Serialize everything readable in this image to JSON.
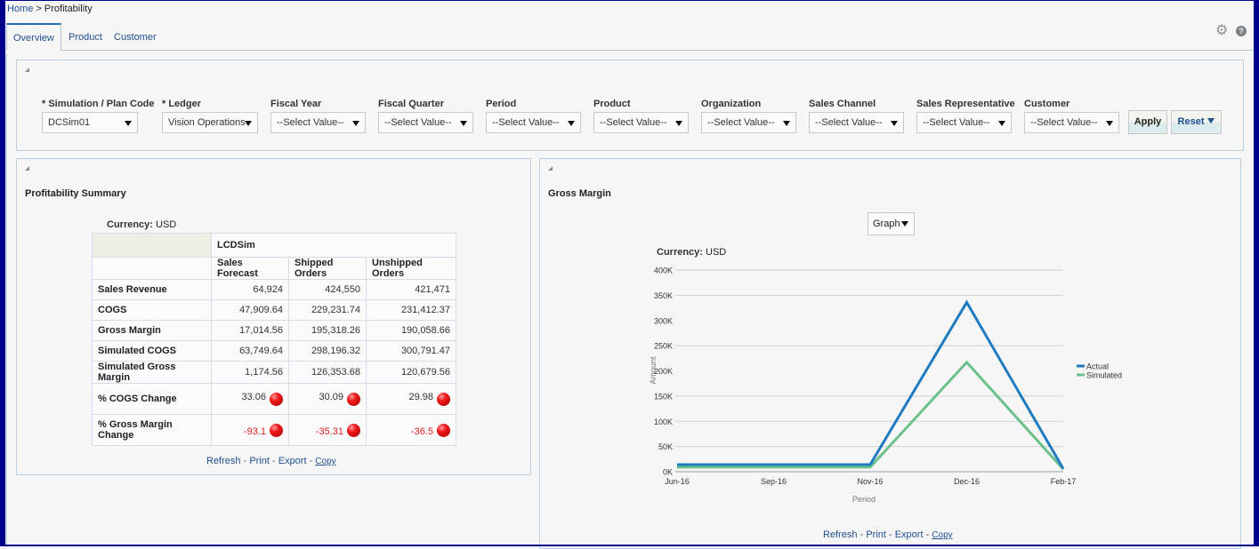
{
  "breadcrumb": {
    "home": "Home",
    "separator": " > ",
    "current": "Profitability"
  },
  "tabs": [
    {
      "label": "Overview",
      "active": true
    },
    {
      "label": "Product",
      "active": false
    },
    {
      "label": "Customer",
      "active": false
    }
  ],
  "header_icons": {
    "settings": "gear-icon",
    "help": "help-icon",
    "help_glyph": "?"
  },
  "filters": {
    "fields": [
      {
        "label": "* Simulation / Plan Code",
        "value": "DCSim01"
      },
      {
        "label": "* Ledger",
        "value": "Vision Operations"
      },
      {
        "label": "Fiscal Year",
        "value": "--Select Value--"
      },
      {
        "label": "Fiscal Quarter",
        "value": "--Select Value--"
      },
      {
        "label": "Period",
        "value": "--Select Value--"
      },
      {
        "label": "Product",
        "value": "--Select Value--"
      },
      {
        "label": "Organization",
        "value": "--Select Value--"
      },
      {
        "label": "Sales Channel",
        "value": "--Select Value--"
      },
      {
        "label": "Sales Representative",
        "value": "--Select Value--"
      },
      {
        "label": "Customer",
        "value": "--Select Value--"
      }
    ],
    "apply_label": "Apply",
    "reset_label": "Reset"
  },
  "summary": {
    "title": "Profitability Summary",
    "currency_label": "Currency:",
    "currency_value": "USD",
    "group_header": "LCDSim",
    "columns": [
      "Sales Forecast",
      "Shipped Orders",
      "Unshipped Orders"
    ],
    "rows": [
      {
        "label": "Sales Revenue",
        "values": [
          "64,924",
          "424,550",
          "421,471"
        ]
      },
      {
        "label": "COGS",
        "values": [
          "47,909.64",
          "229,231.74",
          "231,412.37"
        ]
      },
      {
        "label": "Gross Margin",
        "values": [
          "17,014.56",
          "195,318.26",
          "190,058.66"
        ]
      },
      {
        "label": "Simulated COGS",
        "values": [
          "63,749.64",
          "298,196.32",
          "300,791.47"
        ]
      },
      {
        "label": "Simulated Gross Margin",
        "values": [
          "1,174.56",
          "126,353.68",
          "120,679.56"
        ]
      },
      {
        "label": "% COGS Change",
        "values": [
          "33.06",
          "30.09",
          "29.98"
        ],
        "status": "red"
      },
      {
        "label": "% Gross Margin Change",
        "values": [
          "-93.1",
          "-35.31",
          "-36.5"
        ],
        "status": "red",
        "negative": true
      }
    ],
    "links": {
      "refresh": "Refresh",
      "print": "Print",
      "export": "Export",
      "copy": "Copy",
      "sep": " - "
    }
  },
  "gross_margin": {
    "title": "Gross Margin",
    "view_select": "Graph",
    "currency_label": "Currency:",
    "currency_value": "USD",
    "links": {
      "refresh": "Refresh",
      "print": "Print",
      "export": "Export",
      "copy": "Copy",
      "sep": " - "
    }
  },
  "chart_data": {
    "type": "line",
    "title": "",
    "xlabel": "Period",
    "ylabel": "Amount",
    "categories": [
      "Jun-16",
      "Sep-16",
      "Nov-16",
      "Dec-16",
      "Feb-17"
    ],
    "series": [
      {
        "name": "Actual",
        "color": "#1f7bbf",
        "values": [
          14000,
          14000,
          14000,
          336000,
          6000
        ]
      },
      {
        "name": "Simulated",
        "color": "#6cc08b",
        "values": [
          9000,
          9000,
          9000,
          217000,
          5000
        ]
      }
    ],
    "ylim": [
      0,
      400000
    ],
    "yticks": [
      0,
      50000,
      100000,
      150000,
      200000,
      250000,
      300000,
      350000,
      400000
    ],
    "ytick_labels": [
      "0K",
      "50K",
      "100K",
      "150K",
      "200K",
      "250K",
      "300K",
      "350K",
      "400K"
    ],
    "gridlines_at": [
      50000,
      100000,
      150000,
      250000,
      350000,
      400000
    ],
    "grid": true,
    "legend_position": "right"
  }
}
